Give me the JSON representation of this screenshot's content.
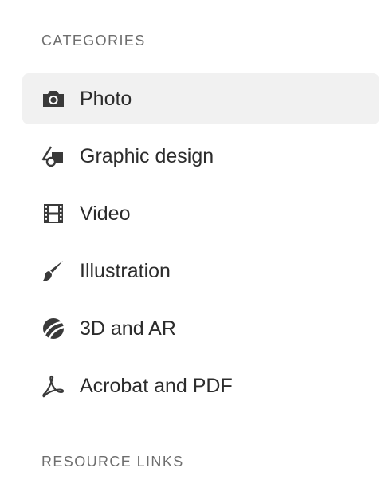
{
  "categories": {
    "heading": "CATEGORIES",
    "selected_index": 0,
    "items": [
      {
        "label": "Photo",
        "icon": "camera-icon"
      },
      {
        "label": "Graphic design",
        "icon": "graphic-design-icon"
      },
      {
        "label": "Video",
        "icon": "film-strip-icon"
      },
      {
        "label": "Illustration",
        "icon": "brush-icon"
      },
      {
        "label": "3D and AR",
        "icon": "3d-ar-icon"
      },
      {
        "label": "Acrobat and PDF",
        "icon": "acrobat-icon"
      }
    ]
  },
  "resource_links": {
    "heading": "RESOURCE LINKS"
  },
  "colors": {
    "text": "#2c2c2c",
    "heading": "#6e6e6e",
    "icon": "#3a3a3a",
    "selected_background": "#f1f1f1"
  }
}
